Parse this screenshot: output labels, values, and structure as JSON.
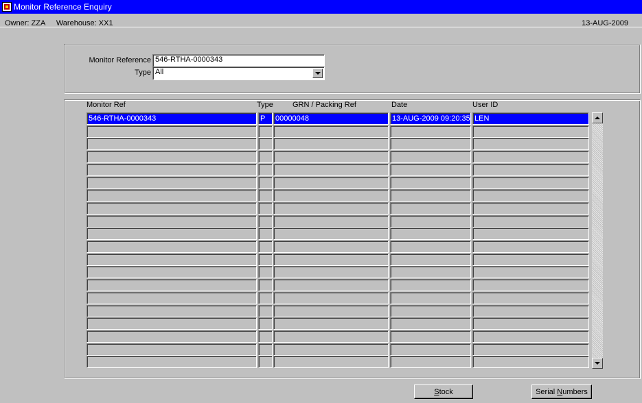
{
  "window": {
    "title": "Monitor Reference Enquiry"
  },
  "infobar": {
    "owner_label": "Owner:",
    "owner_value": "ZZA",
    "warehouse_label": "Warehouse:",
    "warehouse_value": "XX1",
    "date": "13-AUG-2009"
  },
  "search": {
    "monitor_ref_label": "Monitor Reference",
    "monitor_ref_value": "546-RTHA-0000343",
    "type_label": "Type",
    "type_value": "All"
  },
  "grid": {
    "columns": [
      "Monitor Ref",
      "Type",
      "GRN / Packing Ref",
      "Date",
      "User ID"
    ],
    "rows": [
      [
        "546-RTHA-0000343",
        "P",
        "00000048",
        "13-AUG-2009 09:20:35",
        "LEN"
      ],
      [
        "",
        "",
        "",
        "",
        ""
      ],
      [
        "",
        "",
        "",
        "",
        ""
      ],
      [
        "",
        "",
        "",
        "",
        ""
      ],
      [
        "",
        "",
        "",
        "",
        ""
      ],
      [
        "",
        "",
        "",
        "",
        ""
      ],
      [
        "",
        "",
        "",
        "",
        ""
      ],
      [
        "",
        "",
        "",
        "",
        ""
      ],
      [
        "",
        "",
        "",
        "",
        ""
      ],
      [
        "",
        "",
        "",
        "",
        ""
      ],
      [
        "",
        "",
        "",
        "",
        ""
      ],
      [
        "",
        "",
        "",
        "",
        ""
      ],
      [
        "",
        "",
        "",
        "",
        ""
      ],
      [
        "",
        "",
        "",
        "",
        ""
      ],
      [
        "",
        "",
        "",
        "",
        ""
      ],
      [
        "",
        "",
        "",
        "",
        ""
      ],
      [
        "",
        "",
        "",
        "",
        ""
      ],
      [
        "",
        "",
        "",
        "",
        ""
      ],
      [
        "",
        "",
        "",
        "",
        ""
      ],
      [
        "",
        "",
        "",
        "",
        ""
      ]
    ],
    "selected_row": 0
  },
  "buttons": {
    "stock_pre": "",
    "stock_mnemonic": "S",
    "stock_post": "tock",
    "serial_pre": "Serial ",
    "serial_mnemonic": "N",
    "serial_post": "umbers"
  },
  "icons": {
    "app": "app-icon",
    "combo": "chevron-down-icon",
    "scroll_up": "arrow-up-icon",
    "scroll_down": "arrow-down-icon"
  }
}
